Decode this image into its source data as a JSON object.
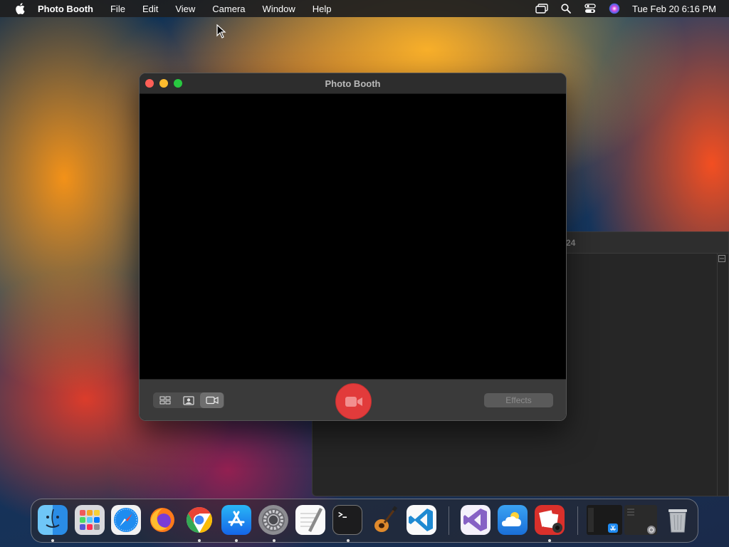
{
  "menubar": {
    "app_name": "Photo Booth",
    "items": [
      "File",
      "Edit",
      "View",
      "Camera",
      "Window",
      "Help"
    ],
    "clock": "Tue Feb 20  6:16 PM",
    "status_icons": [
      "screen-mirroring-icon",
      "search-icon",
      "control-center-icon",
      "siri-icon"
    ]
  },
  "window": {
    "title": "Photo Booth",
    "modes": [
      "grid-mode-icon",
      "photo-mode-icon",
      "video-mode-icon"
    ],
    "active_mode": "video",
    "effects_label": "Effects"
  },
  "background_window": {
    "title_fragment": "24"
  },
  "dock": {
    "apps": [
      "Finder",
      "Launchpad",
      "Safari",
      "Firefox",
      "Google Chrome",
      "App Store",
      "System Settings",
      "TextEdit",
      "Terminal",
      "GarageBand",
      "Visual Studio Code",
      "Visual Studio",
      "Weather",
      "Photo Booth",
      "App Store Window",
      "System Settings Window",
      "Trash"
    ]
  },
  "colors": {
    "record": "#e23b3b",
    "menubar": "#1e1e20",
    "toolbar": "#3a3a3a"
  }
}
